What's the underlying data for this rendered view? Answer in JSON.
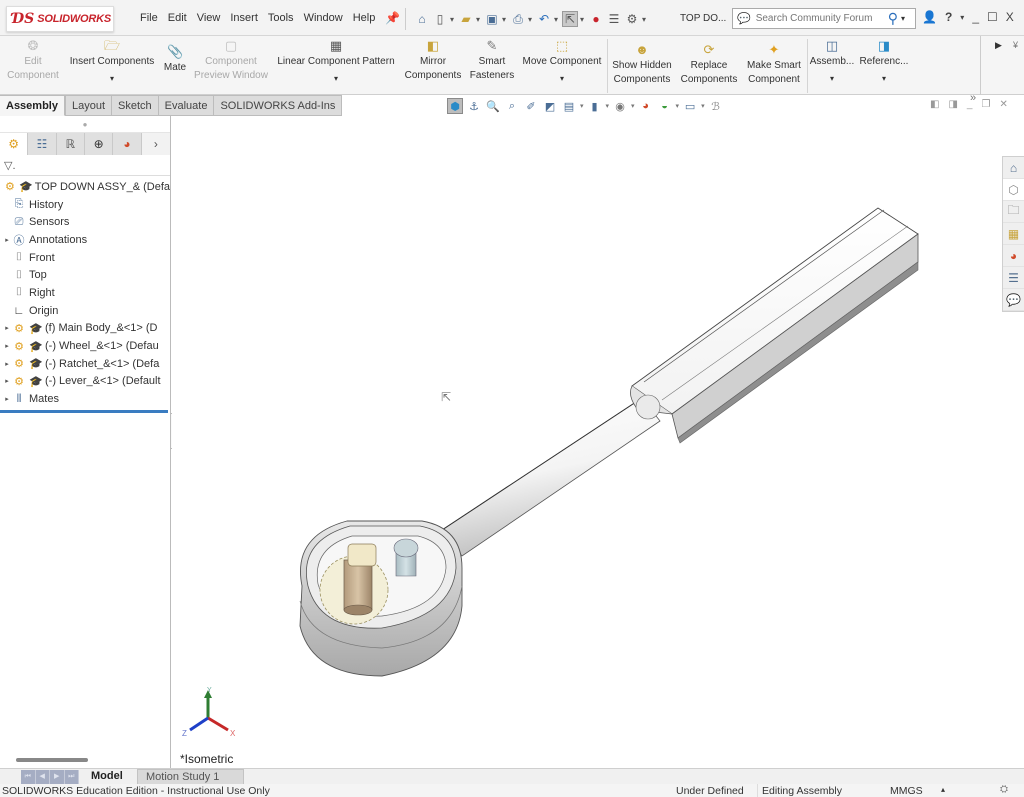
{
  "app": {
    "brand": "SOLIDWORKS",
    "document_title": "TOP DO...",
    "menu": [
      "File",
      "Edit",
      "View",
      "Insert",
      "Tools",
      "Window",
      "Help"
    ],
    "search_placeholder": "Search Community Forum",
    "window_controls": {
      "help": "?",
      "minimize": "_",
      "maximize": "☐",
      "close": "X"
    }
  },
  "quick_access": {
    "icons": [
      "home-icon",
      "new-document-icon",
      "open-icon",
      "save-icon",
      "print-icon",
      "undo-icon",
      "select-icon",
      "rebuild-icon",
      "file-properties-icon",
      "options-icon"
    ]
  },
  "ribbon": {
    "buttons": [
      {
        "id": "edit-component",
        "line1": "Edit",
        "line2": "Component",
        "enabled": false
      },
      {
        "id": "insert-components",
        "line1": "Insert Components",
        "line2": "",
        "enabled": true,
        "has_dropdown": true
      },
      {
        "id": "mate",
        "line1": "Mate",
        "line2": "",
        "enabled": true
      },
      {
        "id": "component-preview-window",
        "line1": "Component",
        "line2": "Preview Window",
        "enabled": false
      },
      {
        "id": "linear-component-pattern",
        "line1": "Linear Component Pattern",
        "line2": "",
        "enabled": true,
        "has_dropdown": true
      },
      {
        "id": "mirror-components",
        "line1": "Mirror",
        "line2": "Components",
        "enabled": true
      },
      {
        "id": "smart-fasteners",
        "line1": "Smart",
        "line2": "Fasteners",
        "enabled": true
      },
      {
        "id": "move-component",
        "line1": "Move Component",
        "line2": "",
        "enabled": true,
        "has_dropdown": true
      },
      {
        "id": "show-hidden-components",
        "line1": "Show Hidden",
        "line2": "Components",
        "enabled": true
      },
      {
        "id": "replace-components",
        "line1": "Replace",
        "line2": "Components",
        "enabled": true
      },
      {
        "id": "make-smart-component",
        "line1": "Make Smart",
        "line2": "Component",
        "enabled": true
      },
      {
        "id": "assembly-features",
        "line1": "Assemb...",
        "line2": "",
        "enabled": true,
        "has_dropdown": true
      },
      {
        "id": "reference-geometry",
        "line1": "Referenc...",
        "line2": "",
        "enabled": true,
        "has_dropdown": true
      }
    ],
    "overflow": "»"
  },
  "tabs": [
    {
      "label": "Assembly",
      "active": true
    },
    {
      "label": "Layout",
      "active": false
    },
    {
      "label": "Sketch",
      "active": false
    },
    {
      "label": "Evaluate",
      "active": false
    },
    {
      "label": "SOLIDWORKS Add-Ins",
      "active": false
    }
  ],
  "heads_up_toolbar": {
    "icons": [
      "view-orientation-icon",
      "previous-view-icon",
      "zoom-to-fit-icon",
      "zoom-to-area-icon",
      "section-view-icon",
      "dynamic-annotation-icon",
      "view-settings-icon",
      "display-style-icon",
      "hide-show-icon",
      "edit-appearance-icon",
      "apply-scene-icon",
      "view-setting-icon",
      "rendering-tools-icon"
    ]
  },
  "feature_tree": {
    "panel_tabs": [
      "featuremanager-icon",
      "propertymanager-icon",
      "configurationmanager-icon",
      "dimxpertmanager-icon",
      "displaymanager-icon"
    ],
    "filter_label": "▽.",
    "items": [
      {
        "label": "TOP DOWN ASSY_&  (Defa",
        "icon": "assembly-icon",
        "expandable": false,
        "level": 0
      },
      {
        "label": "History",
        "icon": "history-icon",
        "expandable": false,
        "level": 1
      },
      {
        "label": "Sensors",
        "icon": "sensors-icon",
        "expandable": false,
        "level": 1
      },
      {
        "label": "Annotations",
        "icon": "annotations-icon",
        "expandable": true,
        "level": 1
      },
      {
        "label": "Front",
        "icon": "plane-icon",
        "expandable": false,
        "level": 1
      },
      {
        "label": "Top",
        "icon": "plane-icon",
        "expandable": false,
        "level": 1
      },
      {
        "label": "Right",
        "icon": "plane-icon",
        "expandable": false,
        "level": 1
      },
      {
        "label": "Origin",
        "icon": "origin-icon",
        "expandable": false,
        "level": 1
      },
      {
        "label": "(f) Main Body_&<1> (D",
        "icon": "part-icon",
        "expandable": true,
        "level": 1
      },
      {
        "label": "(-) Wheel_&<1> (Defau",
        "icon": "part-icon",
        "expandable": true,
        "level": 1
      },
      {
        "label": "(-) Ratchet_&<1> (Defa",
        "icon": "part-icon",
        "expandable": true,
        "level": 1
      },
      {
        "label": "(-) Lever_&<1> (Default",
        "icon": "part-icon",
        "expandable": true,
        "level": 1
      },
      {
        "label": "Mates",
        "icon": "mates-icon",
        "expandable": true,
        "level": 1
      }
    ]
  },
  "viewport": {
    "view_label": "*Isometric",
    "triad": {
      "x": "X",
      "y": "Y",
      "z": "Z"
    },
    "model": "ratchet-wrench-assembly"
  },
  "task_pane": [
    "solidworks-resources-icon",
    "design-library-icon",
    "file-explorer-icon",
    "view-palette-icon",
    "appearances-icon",
    "custom-properties-icon",
    "forum-icon"
  ],
  "bottom_tabs": [
    {
      "label": "Model",
      "active": true
    },
    {
      "label": "Motion Study 1",
      "active": false
    }
  ],
  "status_bar": {
    "edition": "SOLIDWORKS Education Edition - Instructional Use Only",
    "definition": "Under Defined",
    "mode": "Editing Assembly",
    "units": "MMGS"
  },
  "colors": {
    "brand_red": "#c8242c",
    "accent_blue": "#3a7cc1",
    "tab_bg": "#dcdcdc"
  }
}
